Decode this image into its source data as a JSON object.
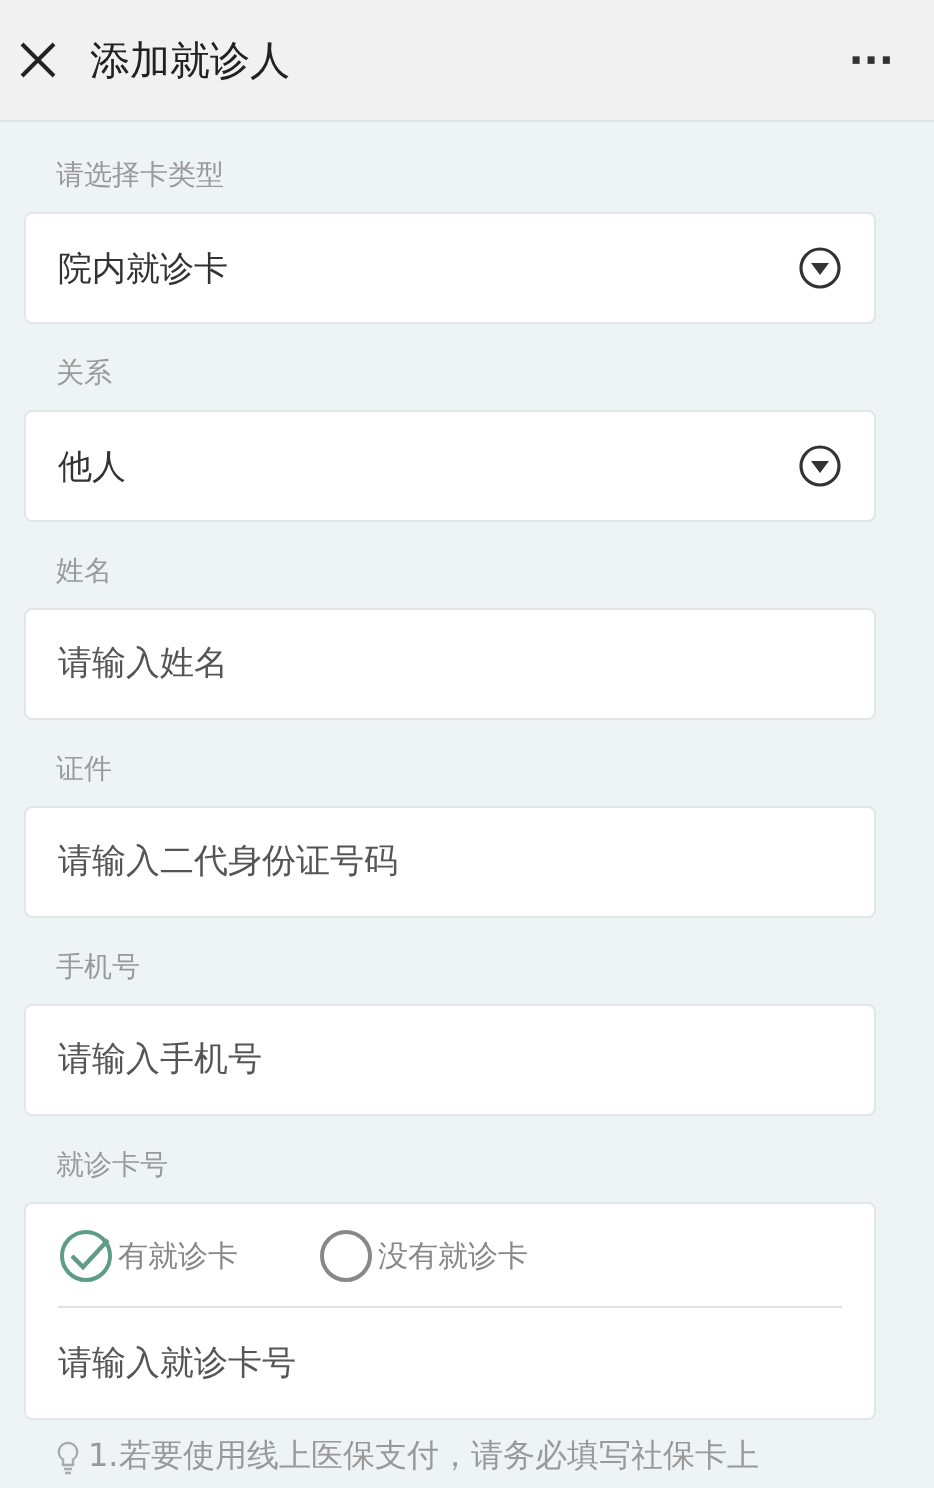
{
  "header": {
    "title": "添加就诊人",
    "more": "···"
  },
  "fields": [
    {
      "kind": "select",
      "label": "请选择卡类型",
      "value": "院内就诊卡"
    },
    {
      "kind": "select",
      "label": "关系",
      "value": "他人"
    },
    {
      "kind": "input",
      "label": "姓名",
      "placeholder": "请输入姓名"
    },
    {
      "kind": "input",
      "label": "证件",
      "placeholder": "请输入二代身份证号码"
    },
    {
      "kind": "input",
      "label": "手机号",
      "placeholder": "请输入手机号"
    }
  ],
  "card_number": {
    "label": "就诊卡号",
    "options": [
      {
        "label": "有就诊卡",
        "selected": true
      },
      {
        "label": "没有就诊卡",
        "selected": false
      }
    ],
    "placeholder": "请输入就诊卡号"
  },
  "hint": "1.若要使用线上医保支付，请务必填写社保卡上"
}
